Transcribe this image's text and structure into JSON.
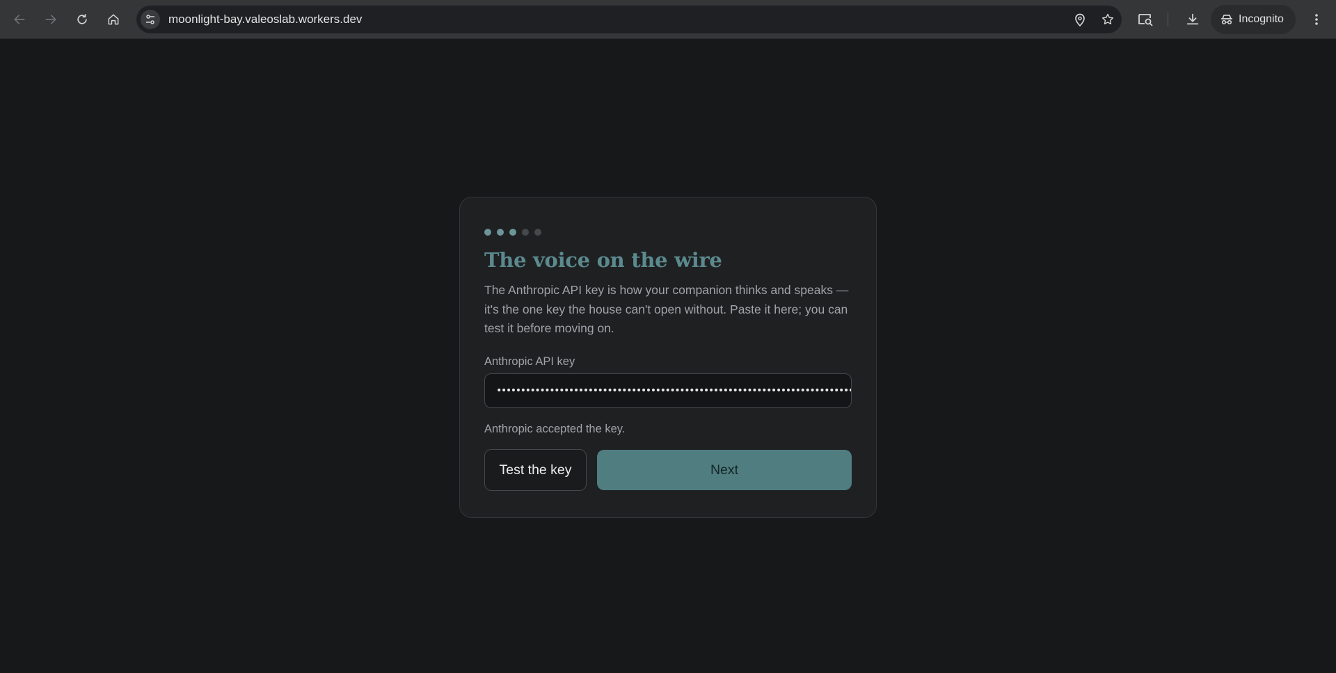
{
  "browser": {
    "url": "moonlight-bay.valeoslab.workers.dev",
    "incognito_label": "Incognito",
    "icons": {
      "back": "arrow-left-icon",
      "forward": "arrow-right-icon",
      "reload": "reload-icon",
      "home": "home-icon",
      "site_info": "tune-icon",
      "location": "location-pin-icon",
      "bookmark": "star-icon",
      "lens": "lens-search-icon",
      "download": "download-icon",
      "incognito": "incognito-icon",
      "menu": "kebab-menu-icon"
    }
  },
  "wizard": {
    "steps_total": 5,
    "steps_done": 3,
    "title": "The voice on the wire",
    "description": "The Anthropic API key is how your companion thinks and speaks — it's the one key the house can't open without. Paste it here; you can test it before moving on.",
    "field_label": "Anthropic API key",
    "key_masked": "•••••••••••••••••••••••••••••••••••••••••••••••••••••••••••••••••••••••••••••••••••••••••••••••••••••",
    "status_text": "Anthropic accepted the key.",
    "test_button": "Test the key",
    "next_button": "Next"
  },
  "colors": {
    "accent": "#5b8a8e",
    "next_bg": "#4f7d80",
    "page_bg": "#17181a",
    "card_bg": "#1f2022"
  }
}
